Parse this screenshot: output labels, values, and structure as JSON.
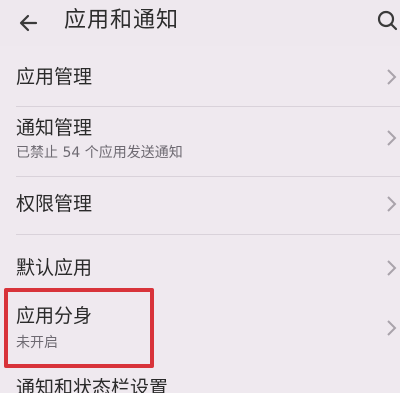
{
  "header": {
    "title": "应用和通知",
    "back_icon": "arrow-left-icon",
    "search_icon": "search-icon"
  },
  "items": [
    {
      "label": "应用管理",
      "sub": ""
    },
    {
      "label": "通知管理",
      "sub": "已禁止 54 个应用发送通知"
    },
    {
      "label": "权限管理",
      "sub": ""
    },
    {
      "label": "默认应用",
      "sub": ""
    },
    {
      "label": "应用分身",
      "sub": "未开启"
    },
    {
      "label": "通知和状态栏设置",
      "sub": ""
    }
  ],
  "colors": {
    "background": "#efe9ef",
    "highlight": "#d8333a"
  }
}
